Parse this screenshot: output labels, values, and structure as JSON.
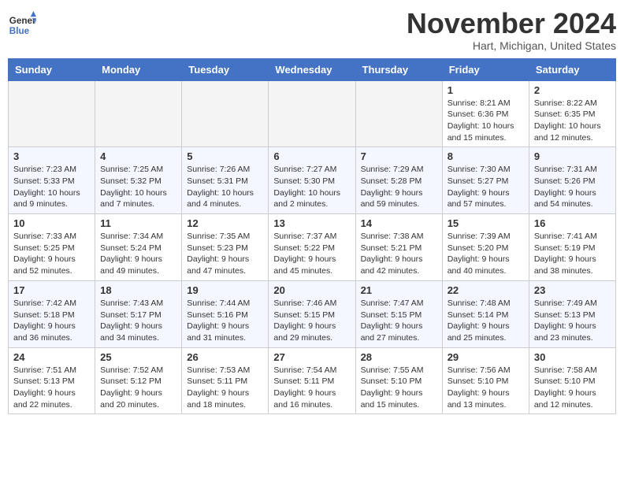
{
  "header": {
    "logo_line1": "General",
    "logo_line2": "Blue",
    "month": "November 2024",
    "location": "Hart, Michigan, United States"
  },
  "days_of_week": [
    "Sunday",
    "Monday",
    "Tuesday",
    "Wednesday",
    "Thursday",
    "Friday",
    "Saturday"
  ],
  "weeks": [
    {
      "stripe": 1,
      "days": [
        {
          "num": "",
          "info": ""
        },
        {
          "num": "",
          "info": ""
        },
        {
          "num": "",
          "info": ""
        },
        {
          "num": "",
          "info": ""
        },
        {
          "num": "",
          "info": ""
        },
        {
          "num": "1",
          "info": "Sunrise: 8:21 AM\nSunset: 6:36 PM\nDaylight: 10 hours and 15 minutes."
        },
        {
          "num": "2",
          "info": "Sunrise: 8:22 AM\nSunset: 6:35 PM\nDaylight: 10 hours and 12 minutes."
        }
      ]
    },
    {
      "stripe": 2,
      "days": [
        {
          "num": "3",
          "info": "Sunrise: 7:23 AM\nSunset: 5:33 PM\nDaylight: 10 hours and 9 minutes."
        },
        {
          "num": "4",
          "info": "Sunrise: 7:25 AM\nSunset: 5:32 PM\nDaylight: 10 hours and 7 minutes."
        },
        {
          "num": "5",
          "info": "Sunrise: 7:26 AM\nSunset: 5:31 PM\nDaylight: 10 hours and 4 minutes."
        },
        {
          "num": "6",
          "info": "Sunrise: 7:27 AM\nSunset: 5:30 PM\nDaylight: 10 hours and 2 minutes."
        },
        {
          "num": "7",
          "info": "Sunrise: 7:29 AM\nSunset: 5:28 PM\nDaylight: 9 hours and 59 minutes."
        },
        {
          "num": "8",
          "info": "Sunrise: 7:30 AM\nSunset: 5:27 PM\nDaylight: 9 hours and 57 minutes."
        },
        {
          "num": "9",
          "info": "Sunrise: 7:31 AM\nSunset: 5:26 PM\nDaylight: 9 hours and 54 minutes."
        }
      ]
    },
    {
      "stripe": 1,
      "days": [
        {
          "num": "10",
          "info": "Sunrise: 7:33 AM\nSunset: 5:25 PM\nDaylight: 9 hours and 52 minutes."
        },
        {
          "num": "11",
          "info": "Sunrise: 7:34 AM\nSunset: 5:24 PM\nDaylight: 9 hours and 49 minutes."
        },
        {
          "num": "12",
          "info": "Sunrise: 7:35 AM\nSunset: 5:23 PM\nDaylight: 9 hours and 47 minutes."
        },
        {
          "num": "13",
          "info": "Sunrise: 7:37 AM\nSunset: 5:22 PM\nDaylight: 9 hours and 45 minutes."
        },
        {
          "num": "14",
          "info": "Sunrise: 7:38 AM\nSunset: 5:21 PM\nDaylight: 9 hours and 42 minutes."
        },
        {
          "num": "15",
          "info": "Sunrise: 7:39 AM\nSunset: 5:20 PM\nDaylight: 9 hours and 40 minutes."
        },
        {
          "num": "16",
          "info": "Sunrise: 7:41 AM\nSunset: 5:19 PM\nDaylight: 9 hours and 38 minutes."
        }
      ]
    },
    {
      "stripe": 2,
      "days": [
        {
          "num": "17",
          "info": "Sunrise: 7:42 AM\nSunset: 5:18 PM\nDaylight: 9 hours and 36 minutes."
        },
        {
          "num": "18",
          "info": "Sunrise: 7:43 AM\nSunset: 5:17 PM\nDaylight: 9 hours and 34 minutes."
        },
        {
          "num": "19",
          "info": "Sunrise: 7:44 AM\nSunset: 5:16 PM\nDaylight: 9 hours and 31 minutes."
        },
        {
          "num": "20",
          "info": "Sunrise: 7:46 AM\nSunset: 5:15 PM\nDaylight: 9 hours and 29 minutes."
        },
        {
          "num": "21",
          "info": "Sunrise: 7:47 AM\nSunset: 5:15 PM\nDaylight: 9 hours and 27 minutes."
        },
        {
          "num": "22",
          "info": "Sunrise: 7:48 AM\nSunset: 5:14 PM\nDaylight: 9 hours and 25 minutes."
        },
        {
          "num": "23",
          "info": "Sunrise: 7:49 AM\nSunset: 5:13 PM\nDaylight: 9 hours and 23 minutes."
        }
      ]
    },
    {
      "stripe": 1,
      "days": [
        {
          "num": "24",
          "info": "Sunrise: 7:51 AM\nSunset: 5:13 PM\nDaylight: 9 hours and 22 minutes."
        },
        {
          "num": "25",
          "info": "Sunrise: 7:52 AM\nSunset: 5:12 PM\nDaylight: 9 hours and 20 minutes."
        },
        {
          "num": "26",
          "info": "Sunrise: 7:53 AM\nSunset: 5:11 PM\nDaylight: 9 hours and 18 minutes."
        },
        {
          "num": "27",
          "info": "Sunrise: 7:54 AM\nSunset: 5:11 PM\nDaylight: 9 hours and 16 minutes."
        },
        {
          "num": "28",
          "info": "Sunrise: 7:55 AM\nSunset: 5:10 PM\nDaylight: 9 hours and 15 minutes."
        },
        {
          "num": "29",
          "info": "Sunrise: 7:56 AM\nSunset: 5:10 PM\nDaylight: 9 hours and 13 minutes."
        },
        {
          "num": "30",
          "info": "Sunrise: 7:58 AM\nSunset: 5:10 PM\nDaylight: 9 hours and 12 minutes."
        }
      ]
    }
  ]
}
